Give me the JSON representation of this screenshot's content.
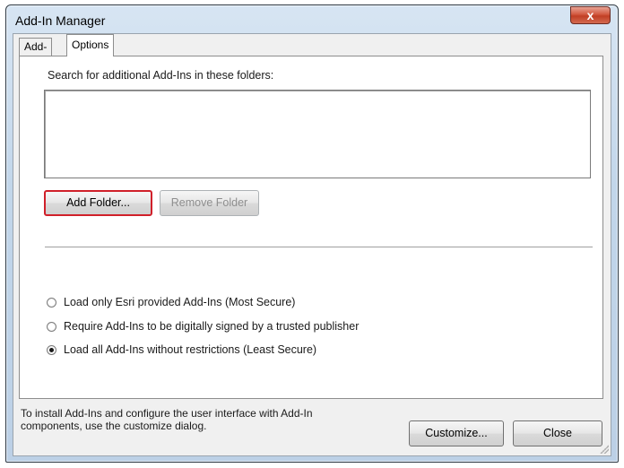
{
  "window": {
    "title": "Add-In Manager",
    "close_glyph": "x"
  },
  "tabs": [
    {
      "label": "Add-Ins",
      "active": false
    },
    {
      "label": "Options",
      "active": true
    }
  ],
  "options": {
    "search_label": "Search for additional Add-Ins in these folders:",
    "folders": [],
    "add_folder_label": "Add Folder...",
    "remove_folder_label": "Remove Folder",
    "radios": [
      {
        "label": "Load only Esri provided Add-Ins (Most Secure)",
        "checked": false
      },
      {
        "label": "Require Add-Ins to be digitally signed by a trusted publisher",
        "checked": false
      },
      {
        "label": "Load all Add-Ins without restrictions (Least Secure)",
        "checked": true
      }
    ]
  },
  "footer": {
    "hint_line1": "To install Add-Ins and configure the user interface with Add-In",
    "hint_line2": "components, use the customize dialog.",
    "customize_label": "Customize...",
    "close_label": "Close"
  },
  "colors": {
    "highlight_border": "#d0202a",
    "close_button": "#c13e24"
  }
}
